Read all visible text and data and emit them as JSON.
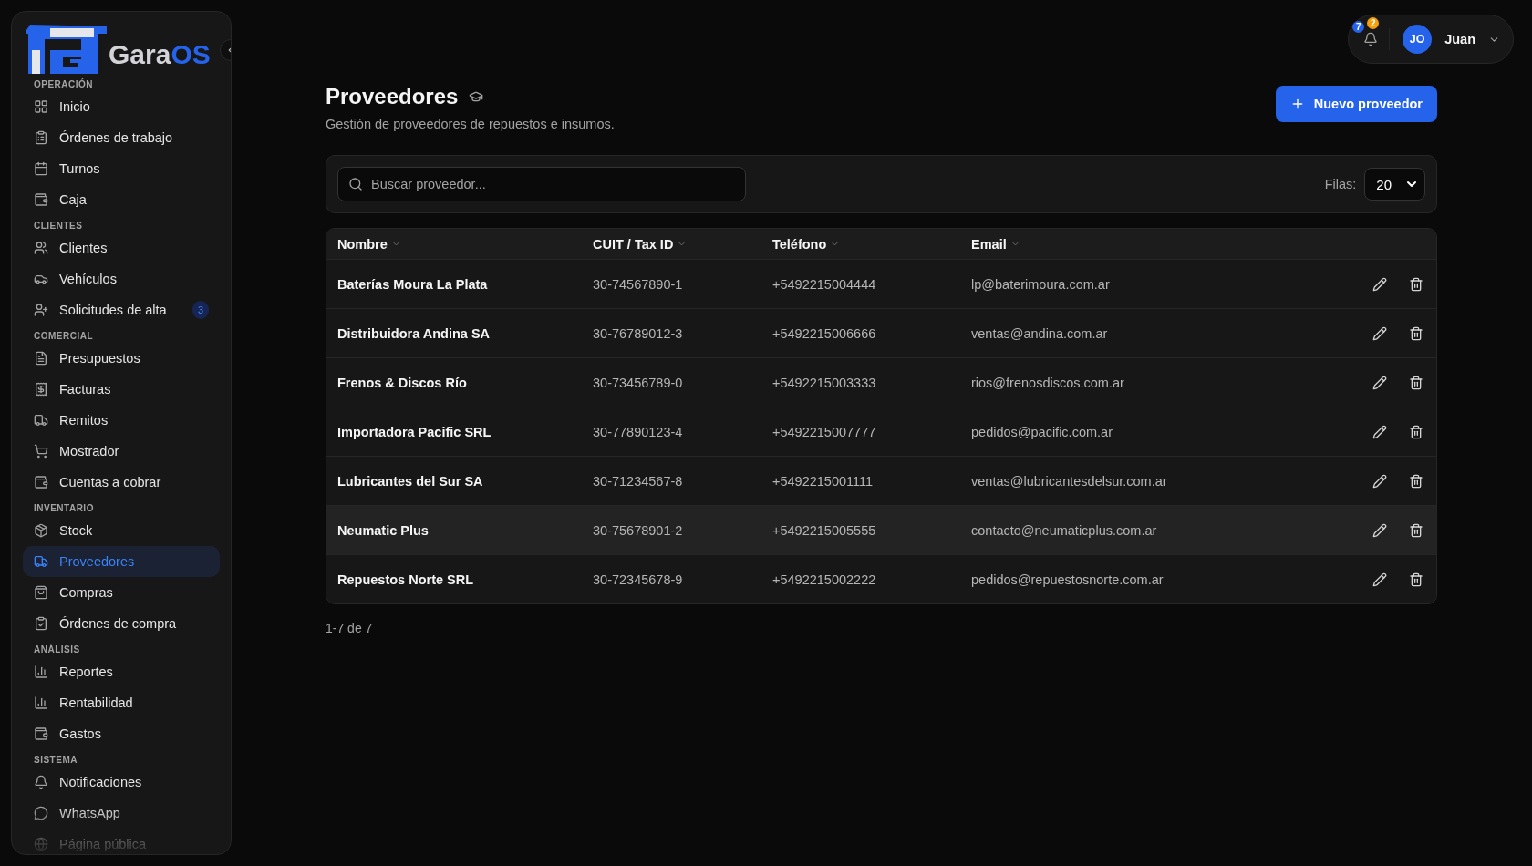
{
  "logo": {
    "name_start": "Gara",
    "name_end": "OS"
  },
  "sidebar": {
    "sections": [
      {
        "label": "OPERACIÓN",
        "items": [
          {
            "label": "Inicio",
            "selected": false
          },
          {
            "label": "Órdenes de trabajo",
            "selected": false
          },
          {
            "label": "Turnos",
            "selected": false
          },
          {
            "label": "Caja",
            "selected": false
          }
        ]
      },
      {
        "label": "CLIENTES",
        "items": [
          {
            "label": "Clientes",
            "selected": false
          },
          {
            "label": "Vehículos",
            "selected": false
          },
          {
            "label": "Solicitudes de alta",
            "selected": false,
            "badge": "3"
          }
        ]
      },
      {
        "label": "COMERCIAL",
        "items": [
          {
            "label": "Presupuestos",
            "selected": false
          },
          {
            "label": "Facturas",
            "selected": false
          },
          {
            "label": "Remitos",
            "selected": false
          },
          {
            "label": "Mostrador",
            "selected": false
          },
          {
            "label": "Cuentas a cobrar",
            "selected": false
          }
        ]
      },
      {
        "label": "INVENTARIO",
        "items": [
          {
            "label": "Stock",
            "selected": false
          },
          {
            "label": "Proveedores",
            "selected": true
          },
          {
            "label": "Compras",
            "selected": false
          },
          {
            "label": "Órdenes de compra",
            "selected": false
          }
        ]
      },
      {
        "label": "ANÁLISIS",
        "items": [
          {
            "label": "Reportes",
            "selected": false
          },
          {
            "label": "Rentabilidad",
            "selected": false
          },
          {
            "label": "Gastos",
            "selected": false
          }
        ]
      },
      {
        "label": "SISTEMA",
        "items": [
          {
            "label": "Notificaciones",
            "selected": false
          },
          {
            "label": "WhatsApp",
            "selected": false
          },
          {
            "label": "Página pública",
            "selected": false
          }
        ]
      }
    ]
  },
  "header": {
    "notification_badges": [
      {
        "count": "7",
        "color": "#2563eb"
      },
      {
        "count": "2",
        "color": "#f59e0b"
      }
    ],
    "user": {
      "initials": "JO",
      "name": "Juan"
    }
  },
  "page": {
    "title": "Proveedores",
    "subtitle": "Gestión de proveedores de repuestos e insumos.",
    "new_button": "Nuevo proveedor"
  },
  "toolbar": {
    "search": {
      "placeholder": "Buscar proveedor..."
    },
    "rows_label": "Filas:",
    "rows_value": "20"
  },
  "table": {
    "columns": [
      "Nombre",
      "CUIT / Tax ID",
      "Teléfono",
      "Email"
    ],
    "rows": [
      {
        "name": "Baterías Moura La Plata",
        "cuit": "30-74567890-1",
        "phone": "+5492215004444",
        "email": "lp@baterimoura.com.ar",
        "hovered": false
      },
      {
        "name": "Distribuidora Andina SA",
        "cuit": "30-76789012-3",
        "phone": "+5492215006666",
        "email": "ventas@andina.com.ar",
        "hovered": false
      },
      {
        "name": "Frenos & Discos Río",
        "cuit": "30-73456789-0",
        "phone": "+5492215003333",
        "email": "rios@frenosdiscos.com.ar",
        "hovered": false
      },
      {
        "name": "Importadora Pacific SRL",
        "cuit": "30-77890123-4",
        "phone": "+5492215007777",
        "email": "pedidos@pacific.com.ar",
        "hovered": false
      },
      {
        "name": "Lubricantes del Sur SA",
        "cuit": "30-71234567-8",
        "phone": "+5492215001111",
        "email": "ventas@lubricantesdelsur.com.ar",
        "hovered": false
      },
      {
        "name": "Neumatic Plus",
        "cuit": "30-75678901-2",
        "phone": "+5492215005555",
        "email": "contacto@neumaticplus.com.ar",
        "hovered": true
      },
      {
        "name": "Repuestos Norte SRL",
        "cuit": "30-72345678-9",
        "phone": "+5492215002222",
        "email": "pedidos@repuestosnorte.com.ar",
        "hovered": false
      }
    ]
  },
  "pagination": "1-7 de 7"
}
